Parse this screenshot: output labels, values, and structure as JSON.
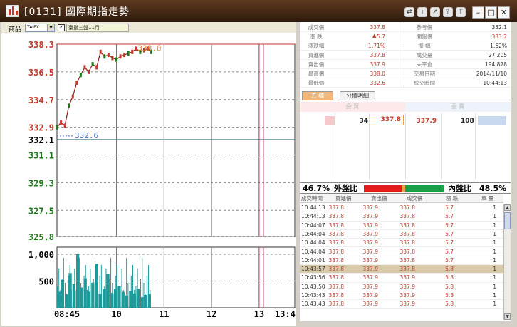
{
  "window": {
    "title": "[0131] 國際期指走勢",
    "toolbar_icons": [
      "export-icon",
      "info-icon",
      "share-icon",
      "help-icon",
      "text-icon"
    ],
    "controls": [
      "minimize",
      "maximize",
      "close"
    ]
  },
  "toolbar": {
    "product_label": "商品",
    "product_value": "TAIEX",
    "checkbox_checked": true,
    "checkbox_label": "臺指三盤11月"
  },
  "chart_data": {
    "type": "line",
    "price_axis": {
      "ticks": [
        "338.3",
        "336.5",
        "334.7",
        "332.9",
        "332.1",
        "331.1",
        "329.3",
        "327.5",
        "325.8"
      ],
      "ylim": [
        325.8,
        338.3
      ]
    },
    "reference_price": "332.1",
    "labels": {
      "high": "338.0",
      "low": "332.6"
    },
    "volume_axis": {
      "ticks": [
        "1,000",
        "500"
      ]
    },
    "time_axis": {
      "ticks": [
        "08:45",
        "10",
        "11",
        "12",
        "13",
        "13:45"
      ]
    },
    "price_series": [
      [
        "08:45",
        332.9
      ],
      [
        "08:50",
        333.2
      ],
      [
        "08:55",
        333.0
      ],
      [
        "09:00",
        334.3
      ],
      [
        "09:05",
        334.9
      ],
      [
        "09:10",
        335.8
      ],
      [
        "09:15",
        336.3
      ],
      [
        "09:20",
        336.8
      ],
      [
        "09:25",
        336.5
      ],
      [
        "09:30",
        337.0
      ],
      [
        "09:35",
        336.8
      ],
      [
        "09:40",
        337.8
      ],
      [
        "09:45",
        337.5
      ],
      [
        "09:50",
        337.6
      ],
      [
        "09:55",
        337.4
      ],
      [
        "10:00",
        337.3
      ],
      [
        "10:05",
        337.5
      ],
      [
        "10:10",
        337.6
      ],
      [
        "10:15",
        337.7
      ],
      [
        "10:20",
        337.8
      ],
      [
        "10:25",
        338.0
      ],
      [
        "10:30",
        337.8
      ],
      [
        "10:35",
        337.9
      ],
      [
        "10:40",
        338.0
      ],
      [
        "10:44",
        337.8
      ]
    ],
    "volume_series": [
      300,
      520,
      250,
      650,
      440,
      1000,
      380,
      550,
      300,
      470,
      820,
      260,
      350,
      640,
      280,
      360,
      400,
      300,
      230,
      320,
      270,
      360,
      200,
      240,
      260
    ],
    "volume_ylim": [
      0,
      1000
    ]
  },
  "quote": {
    "rows": [
      {
        "l1": "成交價",
        "v1": "337.8",
        "l2": "參考價",
        "v2": "332.1"
      },
      {
        "l1": "漲 跌",
        "v1": "5.7",
        "l2": "開盤價",
        "v2": "333.2"
      },
      {
        "l1": "漲跌幅",
        "v1": "1.71%",
        "l2": "振 幅",
        "v2": "1.62%"
      },
      {
        "l1": "買進價",
        "v1": "337.8",
        "l2": "成交量",
        "v2": "27,205"
      },
      {
        "l1": "賣出價",
        "v1": "337.9",
        "l2": "未平倉",
        "v2": "194,878"
      },
      {
        "l1": "最高價",
        "v1": "338.0",
        "l2": "交易日期",
        "v2": "2014/11/10"
      },
      {
        "l1": "最低價",
        "v1": "332.6",
        "l2": "成交時間",
        "v2": "10:44:13"
      }
    ]
  },
  "tabs": [
    "五 檔",
    "分價明細"
  ],
  "book": {
    "bid_head": "委 買",
    "ask_head": "委 賣",
    "bid_qty": "34",
    "bid_price": "337.8",
    "ask_price": "337.9",
    "ask_qty": "108"
  },
  "ratio": {
    "out_pct": "46.7%",
    "out_label": "外盤比",
    "in_label": "內盤比",
    "in_pct": "48.5%"
  },
  "ticks": {
    "headers": [
      "成交時間",
      "買進價",
      "賣出價",
      "成交價",
      "漲 跌",
      "單 量"
    ],
    "rows": [
      [
        "10:44:13",
        "337.8",
        "337.9",
        "337.8",
        "5.7",
        "1"
      ],
      [
        "10:44:13",
        "337.8",
        "337.9",
        "337.8",
        "5.7",
        "1"
      ],
      [
        "10:44:07",
        "337.8",
        "337.9",
        "337.8",
        "5.7",
        "1"
      ],
      [
        "10:44:04",
        "337.8",
        "337.9",
        "337.8",
        "5.7",
        "1"
      ],
      [
        "10:44:04",
        "337.8",
        "337.9",
        "337.8",
        "5.7",
        "1"
      ],
      [
        "10:44:04",
        "337.8",
        "337.9",
        "337.8",
        "5.7",
        "1"
      ],
      [
        "10:44:01",
        "337.8",
        "337.9",
        "337.8",
        "5.7",
        "1"
      ],
      [
        "10:43:57",
        "337.8",
        "337.9",
        "337.8",
        "5.8",
        "1"
      ],
      [
        "10:43:56",
        "337.8",
        "337.9",
        "337.9",
        "5.8",
        "1"
      ],
      [
        "10:43:50",
        "337.8",
        "337.9",
        "337.9",
        "5.8",
        "1"
      ],
      [
        "10:43:43",
        "337.8",
        "337.9",
        "337.9",
        "5.8",
        "1"
      ],
      [
        "10:43:43",
        "337.8",
        "337.9",
        "337.9",
        "5.8",
        "1"
      ]
    ]
  },
  "colors": {
    "title_bar": "#3f2616",
    "price_red": "#c0392b",
    "axis_green": "#1a7a1a",
    "volume": "#1e9a9a",
    "neutral_blue": "#4a6fc0"
  }
}
